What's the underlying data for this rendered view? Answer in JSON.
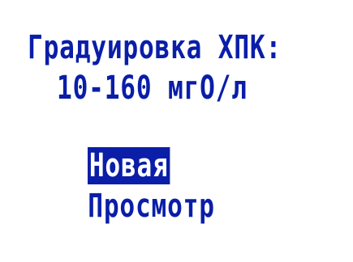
{
  "screen": {
    "title": "Градуировка ХПК:",
    "range": "10-160 мгО/л",
    "menu": {
      "items": [
        {
          "label": "Новая",
          "selected": true
        },
        {
          "label": "Просмотр",
          "selected": false
        }
      ]
    }
  },
  "colors": {
    "text": "#0a1ea8",
    "background": "#ffffff",
    "selection_background": "#0a1ea8",
    "selection_text": "#ffffff"
  }
}
